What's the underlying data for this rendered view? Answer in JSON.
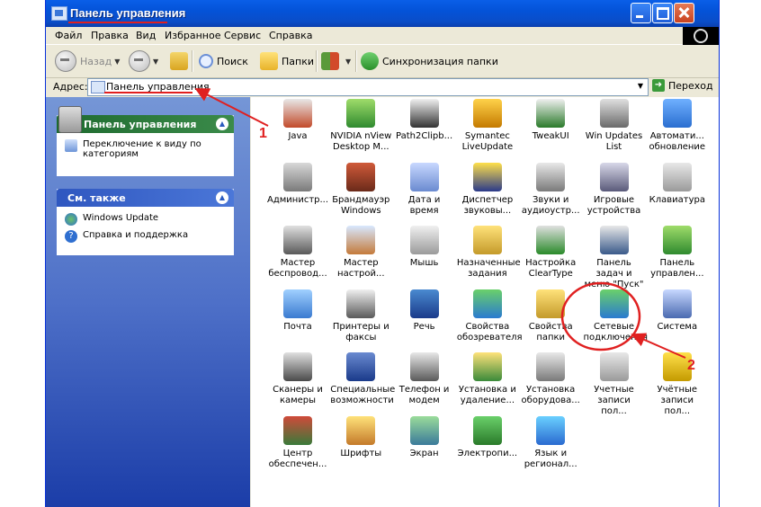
{
  "window": {
    "title": "Панель управления"
  },
  "menu": [
    "Файл",
    "Правка",
    "Вид",
    "Избранное",
    "Сервис",
    "Справка"
  ],
  "toolbar": {
    "back": "Назад",
    "search": "Поиск",
    "folders": "Папки",
    "sync": "Синхронизация папки"
  },
  "address": {
    "label": "Адрес:",
    "value": "Панель управления",
    "go": "Переход"
  },
  "left": {
    "panel1_title": "Панель управления",
    "panel1_link": "Переключение к виду по категориям",
    "panel2_title": "См. также",
    "panel2_links": [
      "Windows Update",
      "Справка и поддержка"
    ]
  },
  "items": [
    "Java",
    "NVIDIA nView Desktop M...",
    "Path2Clipb...",
    "Symantec LiveUpdate",
    "TweakUI",
    "Win Updates List",
    "Автомати... обновление",
    "Администр...",
    "Брандмауэр Windows",
    "Дата и время",
    "Диспетчер звуковы...",
    "Звуки и аудиоустр...",
    "Игровые устройства",
    "Клавиатура",
    "Мастер беспровод...",
    "Мастер настрой...",
    "Мышь",
    "Назначенные задания",
    "Настройка ClearType",
    "Панель задач и меню \"Пуск\"",
    "Панель управлен...",
    "Почта",
    "Принтеры и факсы",
    "Речь",
    "Свойства обозревателя",
    "Свойства папки",
    "Сетевые подключения",
    "Система",
    "Сканеры и камеры",
    "Специальные возможности",
    "Телефон и модем",
    "Установка и удаление...",
    "Установка оборудова...",
    "Учетные записи пол...",
    "Учётные записи пол...",
    "Центр обеспечен...",
    "Шрифты",
    "Экран",
    "Электропи...",
    "Язык и регионал..."
  ],
  "annotations": [
    "1",
    "2"
  ],
  "colors": {
    "annotation": "#e02020",
    "titlebar": "#0453D8",
    "leftpane": "#4e70c8"
  }
}
